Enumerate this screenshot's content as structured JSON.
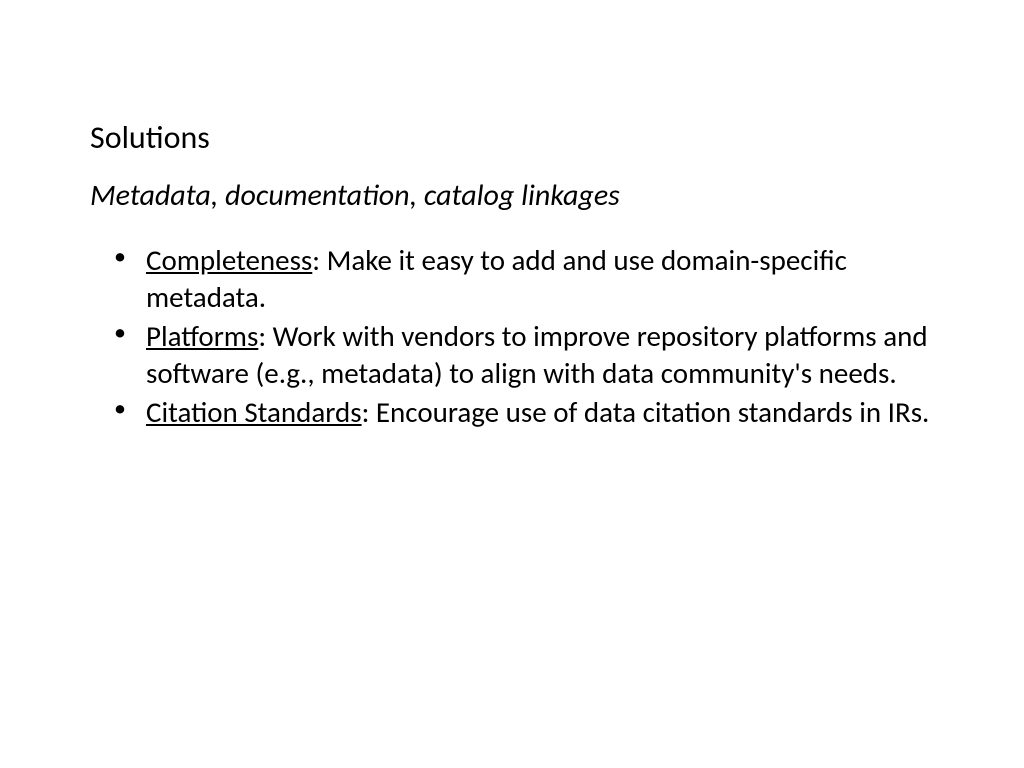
{
  "title": "Solutions",
  "subtitle": "Metadata, documentation, catalog linkages",
  "bullets": [
    {
      "term": "Completeness",
      "text": ": Make it easy to add and use domain-specific metadata."
    },
    {
      "term": "Platforms",
      "text": ": Work with vendors to improve repository platforms and software (e.g., metadata) to align with data community's needs."
    },
    {
      "term": "Citation Standards",
      "text": ": Encourage use of data citation standards in IRs."
    }
  ]
}
